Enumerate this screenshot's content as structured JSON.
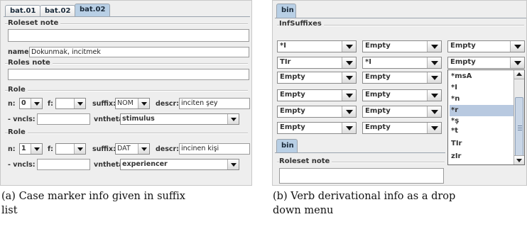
{
  "left_panel": {
    "tabs": [
      "bat.01",
      "bat.02",
      "bat.02"
    ],
    "roleset_note_label": "Roleset note",
    "name_label": "name:",
    "name_value": "Dokunmak, incitmek",
    "roles_note_label": "Roles note",
    "roles": [
      {
        "title": "Role",
        "n_label": "n:",
        "n_value": "0",
        "f_label": "f:",
        "f_value": "",
        "suffix_label": "suffix:",
        "suffix_value": "NOM",
        "descr_label": "descr:",
        "descr_value": "inciten şey",
        "vncls_label": "- vncls:",
        "vncls_value": "",
        "vntheta_label": "vntheta:",
        "vntheta_value": "stimulus"
      },
      {
        "title": "Role",
        "n_label": "n:",
        "n_value": "1",
        "f_label": "f:",
        "f_value": "",
        "suffix_label": "suffix:",
        "suffix_value": "DAT",
        "descr_label": "descr:",
        "descr_value": "incinen kişi",
        "vncls_label": "- vncls:",
        "vncls_value": "",
        "vntheta_label": "vntheta:",
        "vntheta_value": "experiencer"
      }
    ]
  },
  "right_panel": {
    "tab": "bin",
    "infsuffixes_label": "InfSuffixes",
    "grid": [
      [
        "*I",
        "Empty",
        "Empty"
      ],
      [
        "TIr",
        "*I",
        "Empty"
      ],
      [
        "Empty",
        "Empty",
        ""
      ],
      [
        "Empty",
        "Empty",
        ""
      ],
      [
        "Empty",
        "Empty",
        ""
      ],
      [
        "Empty",
        "Empty",
        ""
      ]
    ],
    "dropdown_options": [
      "*msA",
      "*I",
      "*n",
      "*r",
      "*ş",
      "*t",
      "TIr",
      "zIr"
    ],
    "dropdown_selected": "*r",
    "bottom_tab": "bin",
    "roleset_note_label": "Roleset note"
  },
  "captions": {
    "a": [
      "(a) Case marker info given in suffix",
      "list"
    ],
    "b": [
      "(b) Verb derivational info as a drop",
      "down menu"
    ]
  },
  "colors": {
    "panel_bg": "#eeeeee",
    "tab_active": "#b8cfe5",
    "selection": "#b8c9e0"
  }
}
